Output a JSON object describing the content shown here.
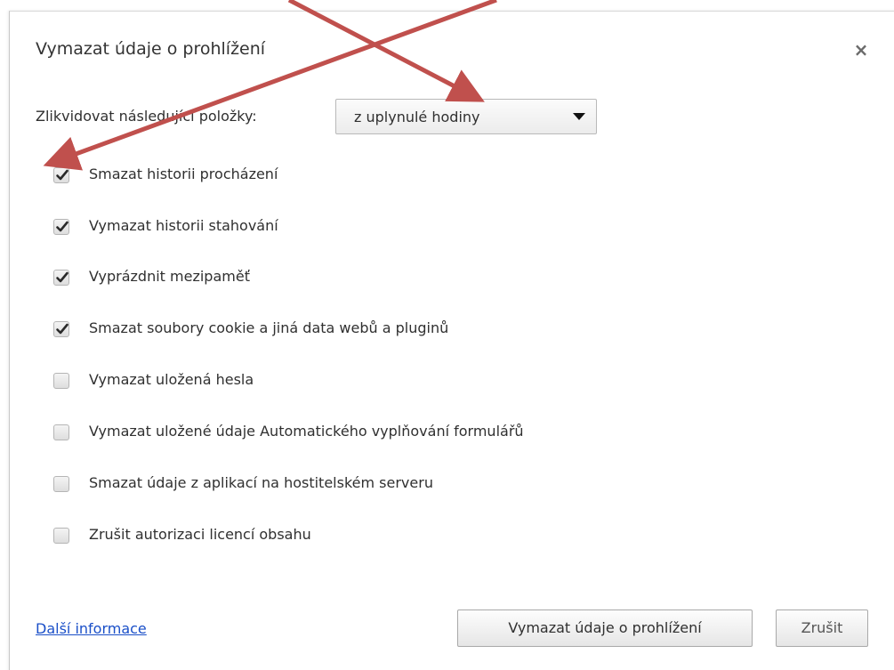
{
  "dialog": {
    "title": "Vymazat údaje o prohlížení",
    "close_symbol": "×"
  },
  "time_range": {
    "label": "Zlikvidovat následující položky:",
    "selected": "z uplynulé hodiny"
  },
  "options": [
    {
      "label": "Smazat historii procházení",
      "checked": true
    },
    {
      "label": "Vymazat historii stahování",
      "checked": true
    },
    {
      "label": "Vyprázdnit mezipaměť",
      "checked": true
    },
    {
      "label": "Smazat soubory cookie a jiná data webů a pluginů",
      "checked": true
    },
    {
      "label": "Vymazat uložená hesla",
      "checked": false
    },
    {
      "label": "Vymazat uložené údaje Automatického vyplňování formulářů",
      "checked": false
    },
    {
      "label": "Smazat údaje z aplikací na hostitelském serveru",
      "checked": false
    },
    {
      "label": "Zrušit autorizaci licencí obsahu",
      "checked": false
    }
  ],
  "footer": {
    "more_info_link": "Další informace",
    "clear_button": "Vymazat údaje o prohlížení",
    "cancel_button": "Zrušit"
  },
  "colors": {
    "annotation_arrow": "#c0504d",
    "link": "#1a4fc8"
  },
  "icons": {
    "close": "close-icon",
    "dropdown": "chevron-down-icon",
    "check": "check-icon"
  }
}
